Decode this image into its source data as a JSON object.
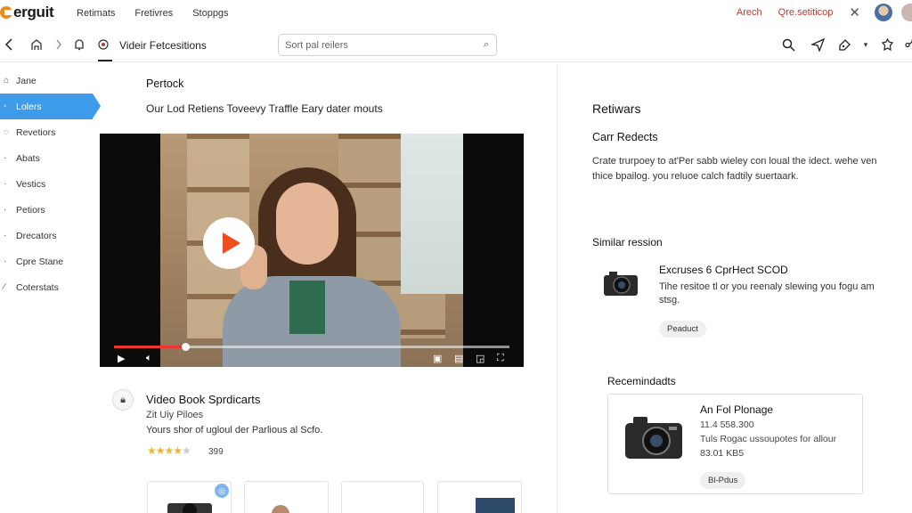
{
  "app": {
    "logo_text": "erguit"
  },
  "top_nav": [
    "Retimats",
    "Fretivres",
    "Stoppgs"
  ],
  "top_right": {
    "search_link": "Arech",
    "action_link": "Qre.setiticop"
  },
  "toolbar": {
    "title": "Videir Fetcesitions"
  },
  "search": {
    "placeholder": "Sort pal reilers"
  },
  "sidebar": {
    "items": [
      {
        "label": "Jane",
        "icon": "home-icon"
      },
      {
        "label": "Lolers",
        "icon": "tag-icon",
        "active": true
      },
      {
        "label": "Revetiors",
        "icon": "review-icon"
      },
      {
        "label": "Abats",
        "icon": "about-icon"
      },
      {
        "label": "Vestics",
        "icon": "list-icon"
      },
      {
        "label": "Petiors",
        "icon": "person-icon"
      },
      {
        "label": "Drecators",
        "icon": "grid-icon"
      },
      {
        "label": "Cpre Stane",
        "icon": "store-icon"
      },
      {
        "label": "Coterstats",
        "icon": "pen-icon"
      }
    ]
  },
  "main": {
    "title": "Pertock",
    "subtitle": "Our Lod Retiens Toveevy Traffle  Eary dater mouts"
  },
  "video": {
    "progress_fraction": 0.18
  },
  "product": {
    "title": "Video Book Sprdicarts",
    "meta": "Zit Uiy Piloes",
    "description": "Yours shor of ugloul der Parlious al Scfo.",
    "rating": 4,
    "rating_max": 5,
    "rating_count": "399"
  },
  "right_panel": {
    "title": "Retiwars",
    "subtitle": "Carr Redects",
    "description": "Crate trurpoey to at'Per sabb wieley con loual the idect. wehe ven thice bpailog. you reluoe calch fadtily suertaark.",
    "similar_heading": "Similar ression",
    "similar_item": {
      "title": "Excruses 6 CprHect SCOD",
      "description": "Tihe resitoe tl or you reenaly slewing you fogu am stsg.",
      "button": "Peaduct"
    },
    "reco_heading": "Recemindadts",
    "reco_item": {
      "title": "An Fol Plonage",
      "price": "11.4 558.300",
      "description": "Tuls Rogac ussoupotes for allour",
      "code": "83.01 KB5",
      "button": "Bl-Pdus"
    }
  },
  "colors": {
    "accent": "#3d9be9",
    "play": "#ee4d1d",
    "star": "#f0b429",
    "link": "#c0392b"
  }
}
